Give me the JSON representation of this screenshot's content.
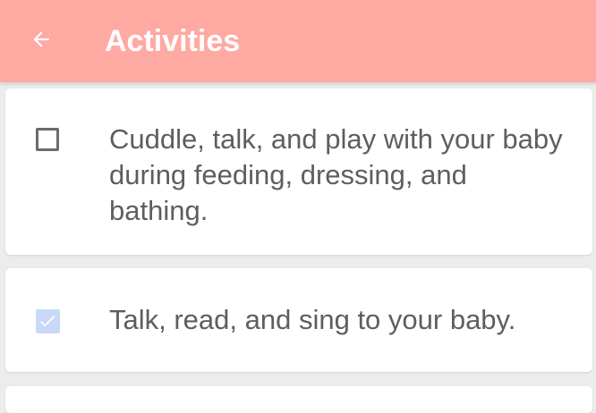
{
  "app_bar": {
    "title": "Activities",
    "back_icon": "arrow-left-icon",
    "background_color": "#ffa9a3"
  },
  "activities": [
    {
      "text": "Cuddle, talk, and play with your baby during feeding, dressing, and bathing.",
      "checked": false
    },
    {
      "text": "Talk, read, and sing to your baby.",
      "checked": true
    }
  ],
  "colors": {
    "checked_box": "#c9d8f7",
    "text": "#5e5e5e"
  }
}
